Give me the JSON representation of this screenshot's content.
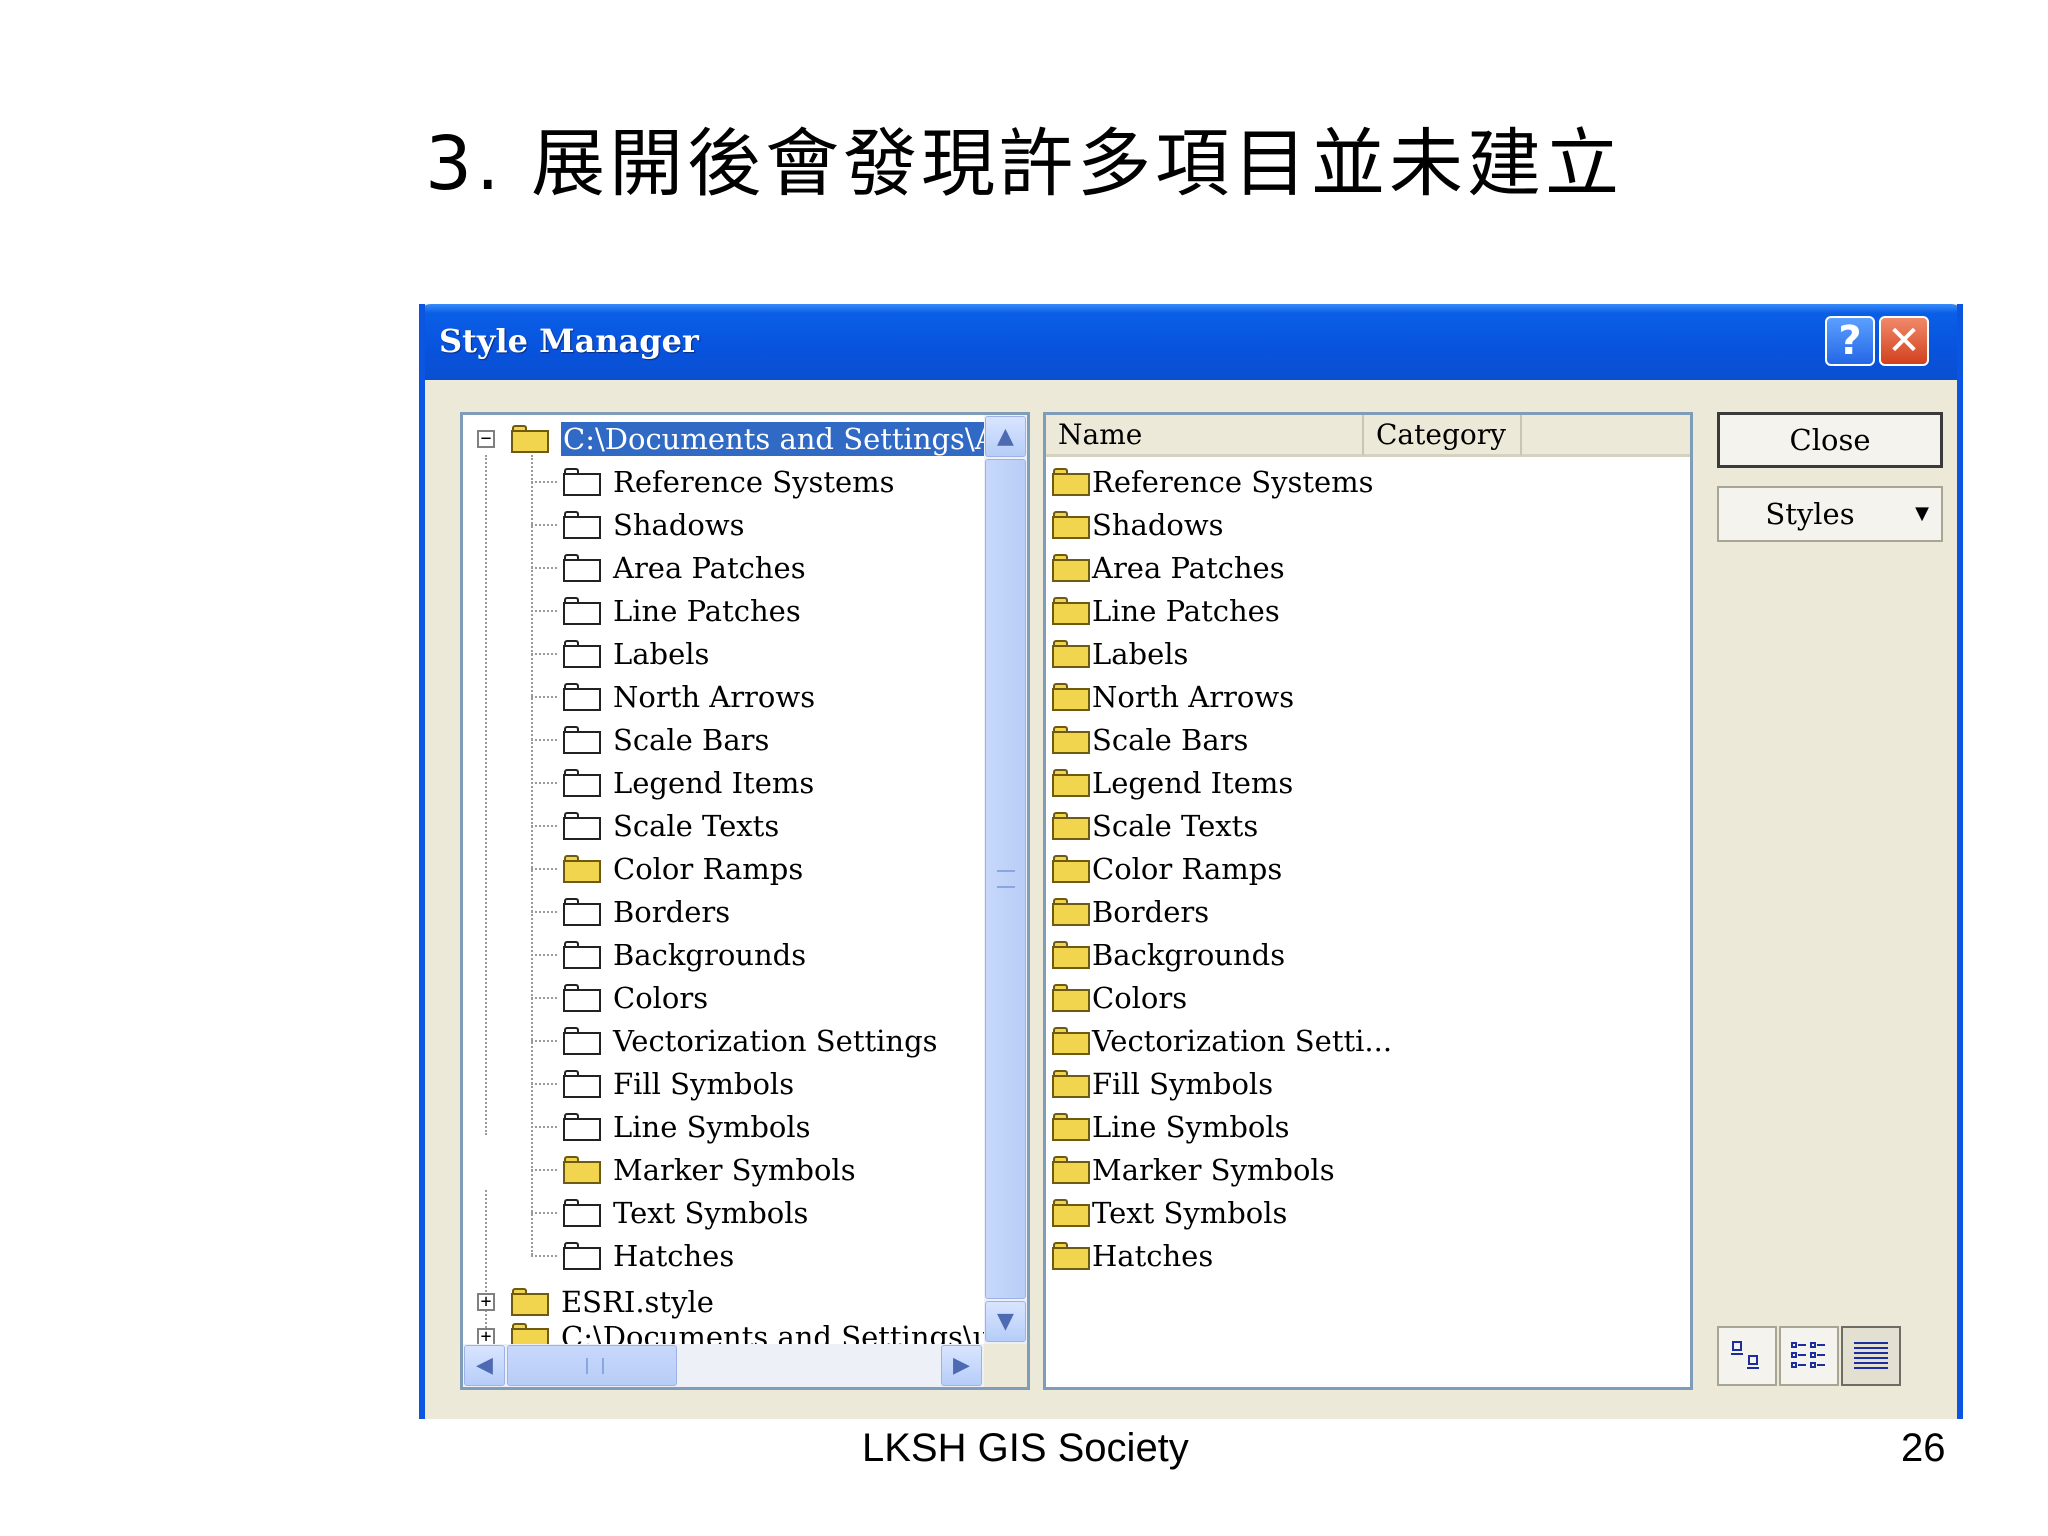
{
  "slide": {
    "title": "3. 展開後會發現許多項目並未建立",
    "footer": "LKSH  GIS Society",
    "page_number": "26"
  },
  "window": {
    "title": "Style Manager",
    "help_label": "?",
    "close_label": "✕"
  },
  "tree": {
    "root_label": "C:\\Documents and Settings\\Admi",
    "items": [
      {
        "label": "Reference Systems",
        "folder": "empty"
      },
      {
        "label": "Shadows",
        "folder": "empty"
      },
      {
        "label": "Area Patches",
        "folder": "empty"
      },
      {
        "label": "Line Patches",
        "folder": "empty"
      },
      {
        "label": "Labels",
        "folder": "empty"
      },
      {
        "label": "North Arrows",
        "folder": "empty"
      },
      {
        "label": "Scale Bars",
        "folder": "empty"
      },
      {
        "label": "Legend Items",
        "folder": "empty"
      },
      {
        "label": "Scale Texts",
        "folder": "empty"
      },
      {
        "label": "Color Ramps",
        "folder": "yellow"
      },
      {
        "label": "Borders",
        "folder": "empty"
      },
      {
        "label": "Backgrounds",
        "folder": "empty"
      },
      {
        "label": "Colors",
        "folder": "empty"
      },
      {
        "label": "Vectorization Settings",
        "folder": "empty"
      },
      {
        "label": "Fill Symbols",
        "folder": "empty"
      },
      {
        "label": "Line Symbols",
        "folder": "empty"
      },
      {
        "label": "Marker Symbols",
        "folder": "yellow"
      },
      {
        "label": "Text Symbols",
        "folder": "empty"
      },
      {
        "label": "Hatches",
        "folder": "empty"
      }
    ],
    "esri_label": "ESRI.style",
    "partial_label": "C:\\Documents and Settings\\user\\A"
  },
  "list": {
    "columns": [
      "Name",
      "Category"
    ],
    "items": [
      "Reference Systems",
      "Shadows",
      "Area Patches",
      "Line Patches",
      "Labels",
      "North Arrows",
      "Scale Bars",
      "Legend Items",
      "Scale Texts",
      "Color Ramps",
      "Borders",
      "Backgrounds",
      "Colors",
      "Vectorization Setti...",
      "Fill Symbols",
      "Line Symbols",
      "Marker Symbols",
      "Text Symbols",
      "Hatches"
    ]
  },
  "buttons": {
    "close_label": "Close",
    "styles_label": "Styles"
  },
  "colors": {
    "title_bar": "#0853dd",
    "selection": "#316ac5",
    "folder_yellow": "#f1d54e"
  },
  "icons": {
    "view_large": "large-icons-view-icon",
    "view_list": "list-view-icon",
    "view_details": "details-view-icon"
  }
}
